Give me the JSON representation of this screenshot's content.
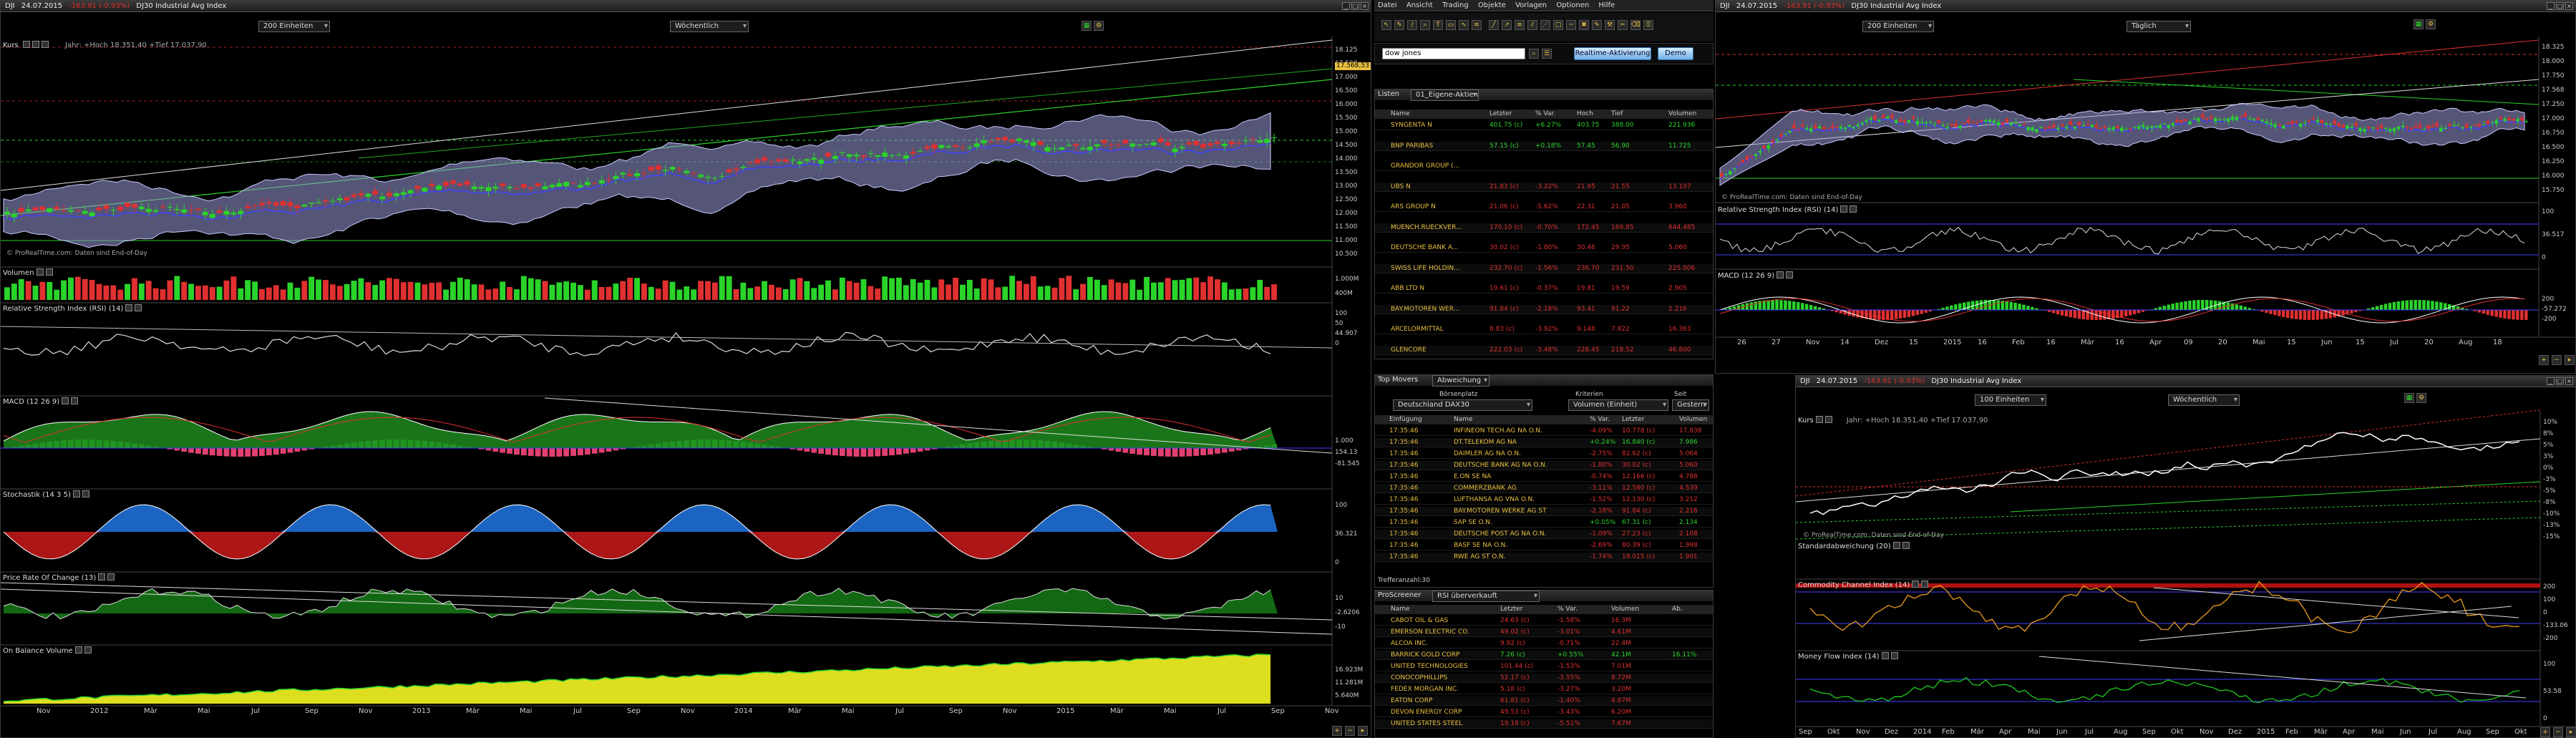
{
  "colors": {
    "up": "#2ad42a",
    "down": "#e03030",
    "band": "#a8a8e8",
    "accent": "#e8c040"
  },
  "left": {
    "title": {
      "symbol": "DJI",
      "date": "24.07.2015",
      "change": "-163.91 (-0.93%)",
      "name": "DJ30 Industrial Avg Index"
    },
    "units": "200 Einheiten",
    "period": "Wöchentlich",
    "panels": {
      "kurs": {
        "label": "Kurs",
        "info": "Jahr: +Hoch 18.351,40 +Tief 17.037,90",
        "credit": "© ProRealTime.com: Daten sind End-of-Day",
        "ticks": [
          "18.125",
          "17.500",
          "17.000",
          "16.500",
          "16.000",
          "15.500",
          "15.000",
          "14.500",
          "14.000",
          "13.500",
          "13.000",
          "12.500",
          "12.000",
          "11.500",
          "11.000",
          "10.500"
        ],
        "last": "17.568,53"
      },
      "volumen": {
        "label": "Volumen",
        "ticks": [
          "1.000M",
          "400M"
        ]
      },
      "rsi": {
        "label": "Relative Strength Index (RSI) (14)",
        "ticks": [
          "100",
          "50",
          "44.907",
          "0"
        ]
      },
      "macd": {
        "label": "MACD (12 26 9)",
        "ticks": [
          "1.000",
          "154.13",
          "-81.545"
        ]
      },
      "stoch": {
        "label": "Stochastik (14 3 5)",
        "ticks": [
          "100",
          "36.321",
          "0"
        ]
      },
      "proc": {
        "label": "Price Rate Of Change (13)",
        "ticks": [
          "10",
          "-2.6206",
          "-10"
        ]
      },
      "obv": {
        "label": "On Balance Volume",
        "ticks": [
          "16.923M",
          "11.281M",
          "5.640M"
        ]
      }
    },
    "xaxis": [
      "Nov",
      "2012",
      "Mär",
      "Mai",
      "Jul",
      "Sep",
      "Nov",
      "2013",
      "Mär",
      "Mai",
      "Jul",
      "Sep",
      "Nov",
      "2014",
      "Mär",
      "Mai",
      "Jul",
      "Sep",
      "Nov",
      "2015",
      "Mär",
      "Mai",
      "Jul",
      "Sep",
      "Nov"
    ]
  },
  "center": {
    "menu": [
      "Datei",
      "Ansicht",
      "Trading",
      "Objekte",
      "Vorlagen",
      "Optionen",
      "Hilfe"
    ],
    "search": "dow jones",
    "realtime_btn": "Realtime-Aktivierung",
    "demo_btn": "Demo",
    "liste": {
      "title": "Listen",
      "selected": "01_Eigene-Aktien",
      "headers": [
        "Name",
        "Letzter",
        "% Var.",
        "Hoch",
        "Tief",
        "Volumen"
      ],
      "rows": [
        {
          "name": "SYNGENTA N",
          "last": "401.75 (c)",
          "var": "+6.27%",
          "hi": "403.75",
          "lo": "388.00",
          "vol": "221.936",
          "cls": "pos"
        },
        {
          "name": "BNP PARIBAS",
          "last": "57.15 (c)",
          "var": "+0.18%",
          "hi": "57.45",
          "lo": "56.90",
          "vol": "11.725",
          "cls": "pos"
        },
        {
          "name": "GRANDOR GROUP (...",
          "last": "",
          "var": "",
          "hi": "",
          "lo": "",
          "vol": "",
          "cls": "mut"
        },
        {
          "name": "UBS N",
          "last": "21.83 (c)",
          "var": "-3.22%",
          "hi": "21.95",
          "lo": "21.55",
          "vol": "13.107",
          "cls": "neg"
        },
        {
          "name": "ARS GROUP N",
          "last": "21.06 (c)",
          "var": "-5.62%",
          "hi": "22.31",
          "lo": "21.05",
          "vol": "3.960",
          "cls": "neg"
        },
        {
          "name": "MUENCH.RUECKVER...",
          "last": "170.10 (c)",
          "var": "-0.70%",
          "hi": "172.45",
          "lo": "169.85",
          "vol": "644.485",
          "cls": "neg"
        },
        {
          "name": "DEUTSCHE BANK A...",
          "last": "30.02 (c)",
          "var": "-1.80%",
          "hi": "30.46",
          "lo": "29.95",
          "vol": "5.060",
          "cls": "neg"
        },
        {
          "name": "SWISS LIFE HOLDIN...",
          "last": "232.70 (c)",
          "var": "-1.56%",
          "hi": "236.70",
          "lo": "231.50",
          "vol": "225.006",
          "cls": "neg"
        },
        {
          "name": "ABB LTD N",
          "last": "19.61 (c)",
          "var": "-0.37%",
          "hi": "19.81",
          "lo": "19.59",
          "vol": "2.905",
          "cls": "neg"
        },
        {
          "name": "BAY.MOTOREN WER...",
          "last": "91.84 (c)",
          "var": "-2.18%",
          "hi": "93.41",
          "lo": "91.22",
          "vol": "2.216",
          "cls": "neg"
        },
        {
          "name": "ARCELORMITTAL",
          "last": "8.83 (c)",
          "var": "-3.92%",
          "hi": "9.148",
          "lo": "7.822",
          "vol": "16.363",
          "cls": "neg"
        },
        {
          "name": "GLENCORE",
          "last": "222.03 (c)",
          "var": "-3.48%",
          "hi": "228.45",
          "lo": "218.52",
          "vol": "46.800",
          "cls": "neg"
        }
      ]
    },
    "movers": {
      "title": "Top Movers",
      "mode": "Abweichung",
      "lbl_place": "Börsenplatz",
      "lbl_crit": "Kriterien",
      "lbl_since": "Seit",
      "place": "Deutschland DAX30",
      "crit": "Volumen (Einheit)",
      "since": "Gestern",
      "headers": [
        "Einfügung",
        "Name",
        "% Var.",
        "Letzter",
        "Volumen"
      ],
      "rows": [
        {
          "t": "17:35:46",
          "name": "INFINEON TECH.AG NA O.N.",
          "var": "-4.09%",
          "last": "10.778 (c)",
          "vol": "17.838",
          "cls": "neg"
        },
        {
          "t": "17:35:46",
          "name": "DT.TELEKOM AG NA",
          "var": "+0.24%",
          "last": "16.840 (c)",
          "vol": "7.986",
          "cls": "pos"
        },
        {
          "t": "17:35:46",
          "name": "DAIMLER AG NA O.N.",
          "var": "-2.75%",
          "last": "82.62 (c)",
          "vol": "5.064",
          "cls": "neg"
        },
        {
          "t": "17:35:46",
          "name": "DEUTSCHE BANK AG NA O.N.",
          "var": "-1.80%",
          "last": "30.02 (c)",
          "vol": "5.060",
          "cls": "neg"
        },
        {
          "t": "17:35:46",
          "name": "E.ON SE NA",
          "var": "-0.74%",
          "last": "12.166 (c)",
          "vol": "4.788",
          "cls": "neg"
        },
        {
          "t": "17:35:46",
          "name": "COMMERZBANK AG",
          "var": "-3.11%",
          "last": "12.580 (c)",
          "vol": "4.539",
          "cls": "neg"
        },
        {
          "t": "17:35:46",
          "name": "LUFTHANSA AG VNA O.N.",
          "var": "-1.52%",
          "last": "12.130 (c)",
          "vol": "3.212",
          "cls": "neg"
        },
        {
          "t": "17:35:46",
          "name": "BAY.MOTOREN WERKE AG ST",
          "var": "-2.18%",
          "last": "91.84 (c)",
          "vol": "2.216",
          "cls": "neg"
        },
        {
          "t": "17:35:46",
          "name": "SAP SE O.N.",
          "var": "+0.05%",
          "last": "67.31 (c)",
          "vol": "2.134",
          "cls": "pos"
        },
        {
          "t": "17:35:46",
          "name": "DEUTSCHE POST AG NA O.N.",
          "var": "-1.09%",
          "last": "27.23 (c)",
          "vol": "2.108",
          "cls": "neg"
        },
        {
          "t": "17:35:46",
          "name": "BASF SE NA O.N.",
          "var": "-2.69%",
          "last": "80.39 (c)",
          "vol": "1.988",
          "cls": "neg"
        },
        {
          "t": "17:35:46",
          "name": "RWE AG ST O.N.",
          "var": "-1.74%",
          "last": "19.015 (c)",
          "vol": "1.901",
          "cls": "neg"
        }
      ],
      "count": "Trefferanzahl:30"
    },
    "screener": {
      "title": "ProScreener",
      "sel": "RSI überverkauft",
      "headers": [
        "Name",
        "Letzter",
        "% Var.",
        "Volumen",
        "Ab."
      ],
      "rows": [
        {
          "name": "CABOT OIL & GAS",
          "last": "24.63 (c)",
          "var": "-1.58%",
          "vol": "16.3M",
          "ab": "",
          "cls": "neg"
        },
        {
          "name": "EMERSON ELECTRIC CO.",
          "last": "49.02 (c)",
          "var": "-3.01%",
          "vol": "4.61M",
          "ab": "",
          "cls": "neg"
        },
        {
          "name": "ALCOA INC.",
          "last": "9.92 (c)",
          "var": "-0.71%",
          "vol": "22.4M",
          "ab": "",
          "cls": "neg"
        },
        {
          "name": "BARRICK GOLD CORP",
          "last": "7.26 (c)",
          "var": "+0.55%",
          "vol": "42.1M",
          "ab": "16.11%",
          "cls": "pos"
        },
        {
          "name": "UNITED TECHNOLOGIES",
          "last": "101.44 (c)",
          "var": "-1.53%",
          "vol": "7.01M",
          "ab": "",
          "cls": "neg"
        },
        {
          "name": "CONOCOPHILLIPS",
          "last": "52.17 (c)",
          "var": "-3.55%",
          "vol": "8.72M",
          "ab": "",
          "cls": "neg"
        },
        {
          "name": "FEDEX MORGAN INC.",
          "last": "5.18 (c)",
          "var": "-3.27%",
          "vol": "3.20M",
          "ab": "",
          "cls": "neg"
        },
        {
          "name": "EATON CORP",
          "last": "61.81 (c)",
          "var": "-1.40%",
          "vol": "4.87M",
          "ab": "",
          "cls": "neg"
        },
        {
          "name": "DEVON ENERGY CORP",
          "last": "49.53 (c)",
          "var": "-3.43%",
          "vol": "6.20M",
          "ab": "",
          "cls": "neg"
        },
        {
          "name": "UNITED STATES STEEL",
          "last": "19.18 (c)",
          "var": "-5.51%",
          "vol": "7.67M",
          "ab": "",
          "cls": "neg"
        }
      ]
    }
  },
  "rtop": {
    "title": {
      "symbol": "DJI",
      "date": "24.07.2015",
      "change": "-163.91 (-0.93%)",
      "name": "DJ30 Industrial Avg Index"
    },
    "units": "200 Einheiten",
    "period": "Täglich",
    "credit": "© ProRealTime.com: Daten sind End-of-Day",
    "rsi_label": "Relative Strength Index (RSI) (14)",
    "rsi_ticks": [
      "100",
      "36.517",
      "0"
    ],
    "macd_label": "MACD (12 26 9)",
    "macd_ticks": [
      "200",
      "-57.272",
      "-200"
    ],
    "ticks": [
      "18.325",
      "18.000",
      "17.750",
      "17.568",
      "17.250",
      "17.000",
      "16.750",
      "16.500",
      "16.250",
      "16.000",
      "15.750"
    ],
    "xaxis": [
      "26",
      "27",
      "Nov",
      "14",
      "Dez",
      "15",
      "2015",
      "16",
      "Feb",
      "16",
      "Mär",
      "16",
      "Apr",
      "09",
      "20",
      "Mai",
      "15",
      "Jun",
      "15",
      "Jul",
      "20",
      "Aug",
      "18"
    ]
  },
  "rbot": {
    "title": {
      "symbol": "DJI",
      "date": "24.07.2015",
      "change": "-163.91 (-0.93%)",
      "name": "DJ30 Industrial Avg Index"
    },
    "units": "100 Einheiten",
    "period": "Wöchentlich",
    "kurs_info": "Jahr: +Hoch 18.351,40 +Tief 17.037,90",
    "credit": "© ProRealTime.com: Daten sind End-of-Day",
    "std_label": "Standardabweichung (20)",
    "cci_label": "Commodity Channel Index (14)",
    "cci_ticks": [
      "200",
      "100",
      "0",
      "-133.06",
      "-200"
    ],
    "mfi_label": "Money Flow Index (14)",
    "mfi_ticks": [
      "100",
      "53.58",
      "0"
    ],
    "pct": [
      "10%",
      "8%",
      "5%",
      "3%",
      "0%",
      "-3%",
      "-5%",
      "-8%",
      "-10%",
      "-13%",
      "-15%"
    ],
    "xaxis": [
      "Sep",
      "Okt",
      "Nov",
      "Dez",
      "2014",
      "Feb",
      "Mär",
      "Apr",
      "Mai",
      "Jun",
      "Jul",
      "Aug",
      "Sep",
      "Okt",
      "Nov",
      "Dez",
      "2015",
      "Feb",
      "Mär",
      "Apr",
      "Mai",
      "Jun",
      "Jul",
      "Aug",
      "Sep",
      "Okt"
    ]
  }
}
